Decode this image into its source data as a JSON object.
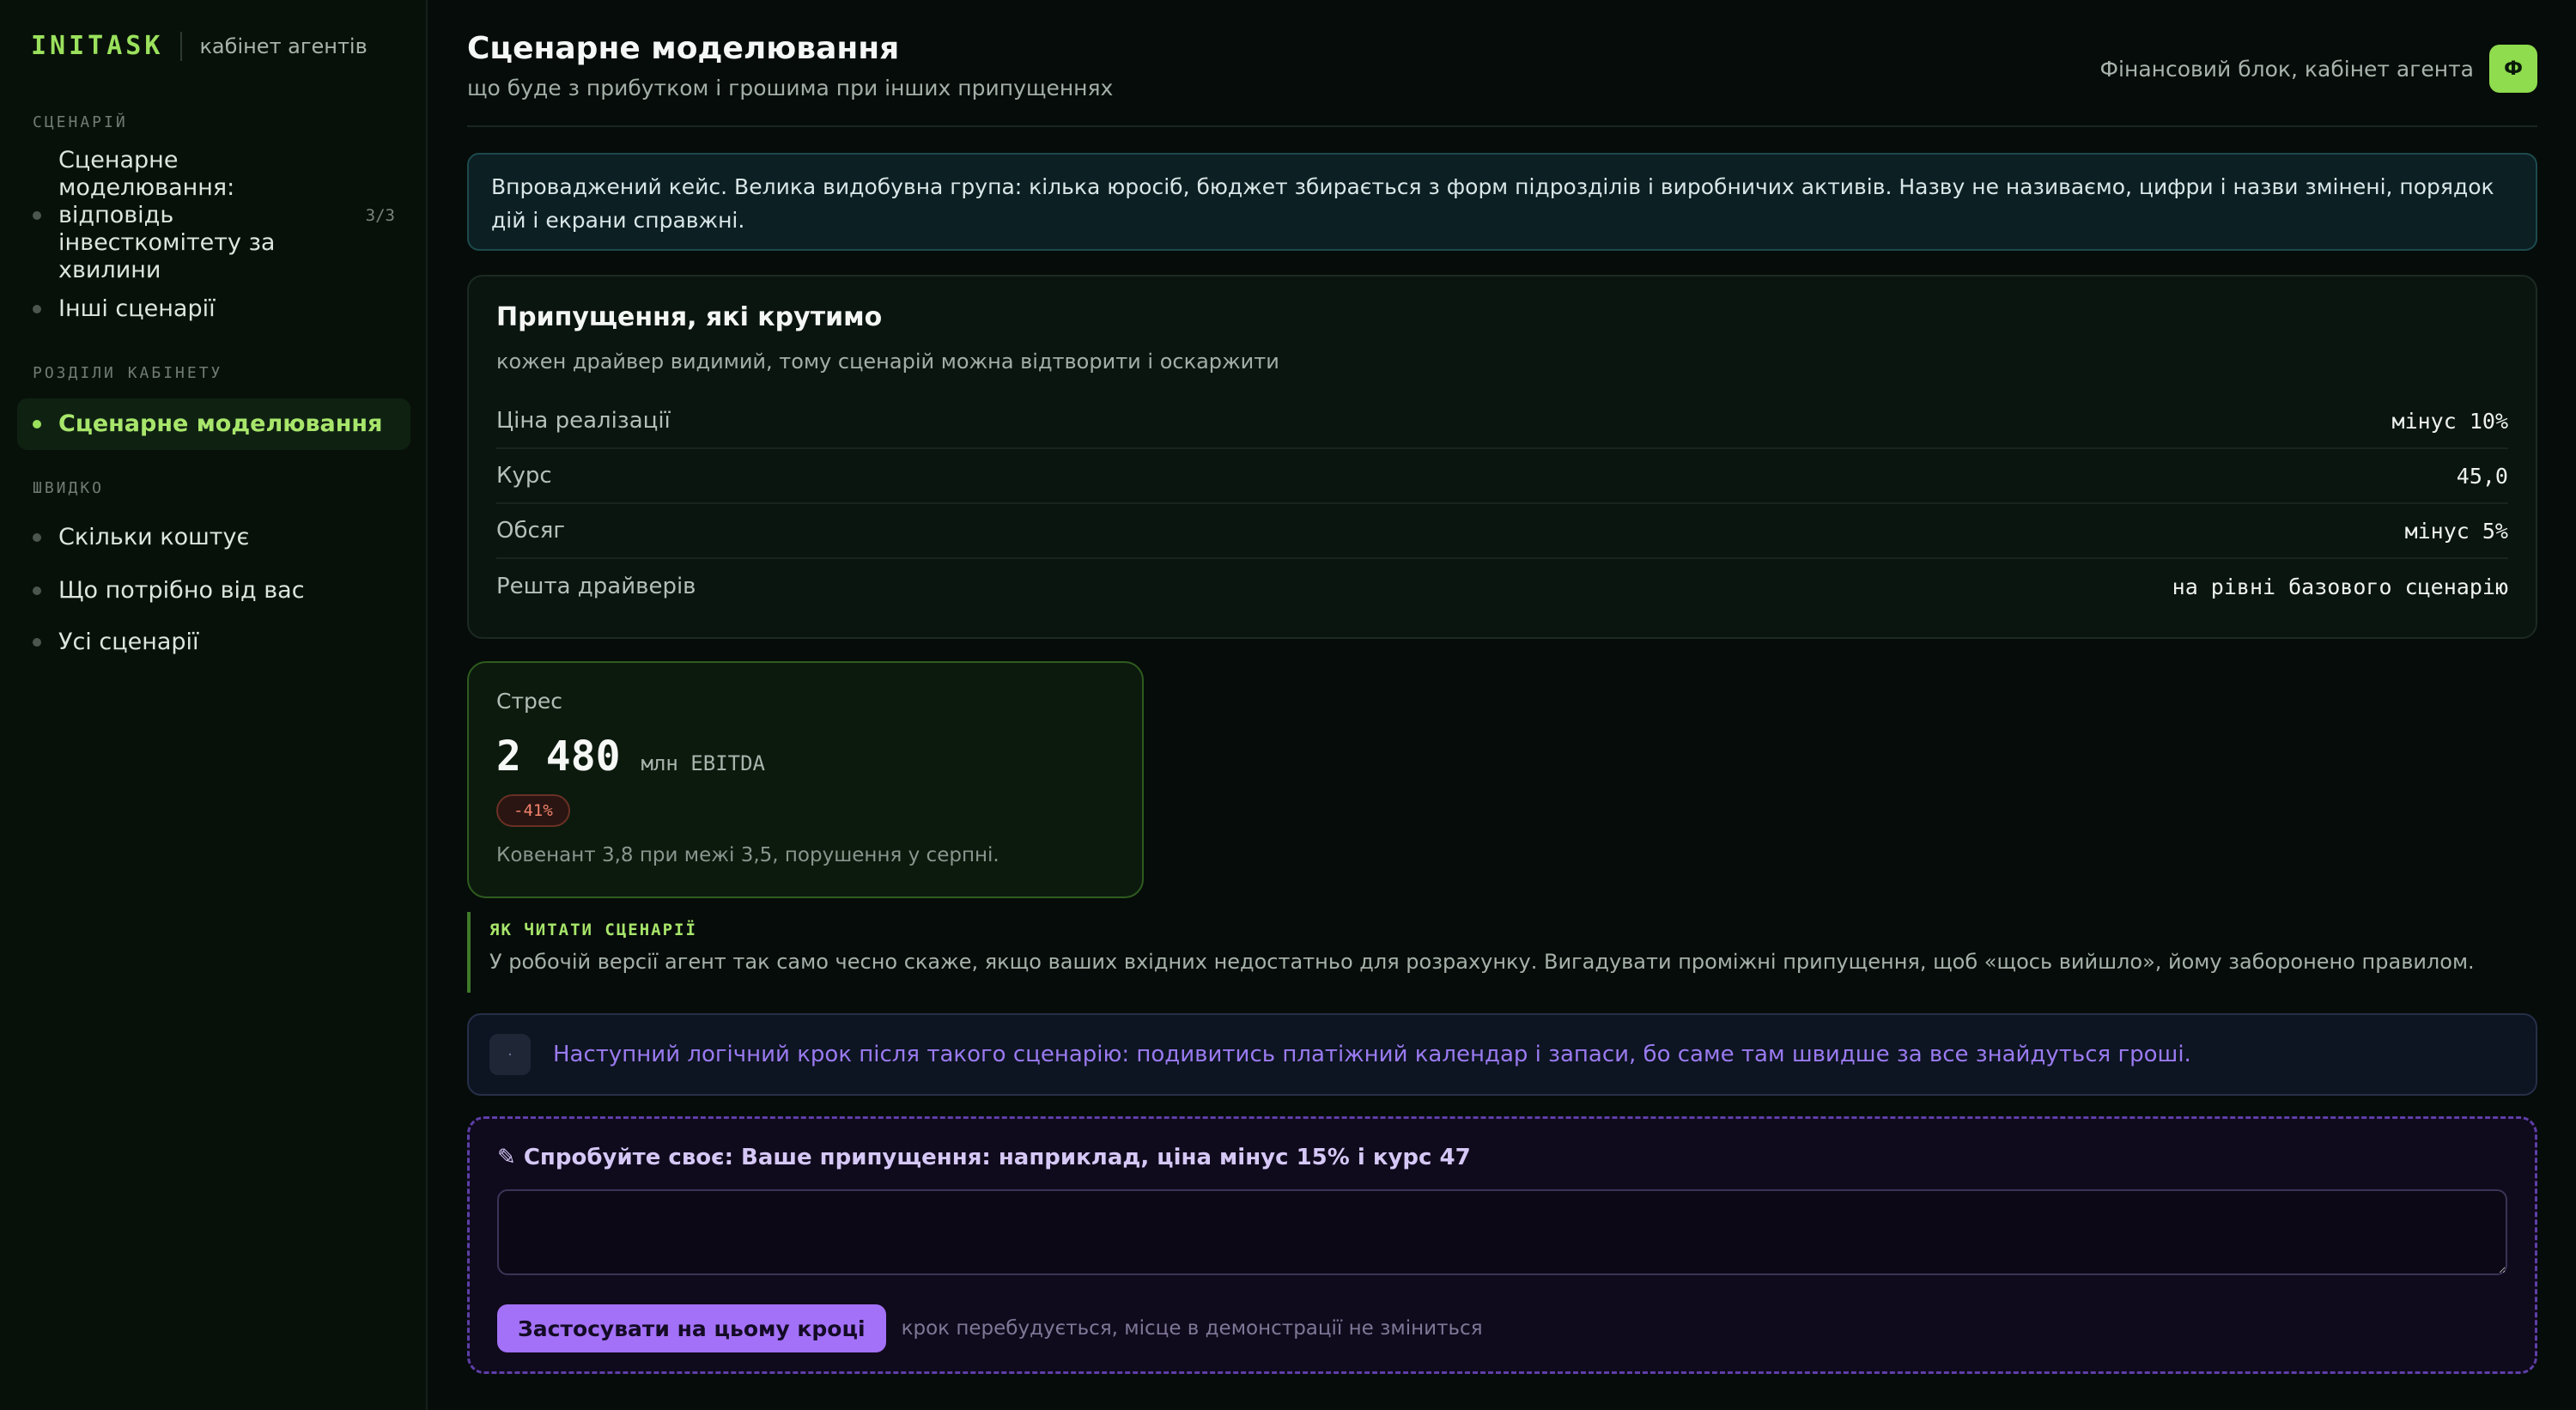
{
  "brand": {
    "logo": "INITASK",
    "subtitle": "кабінет агентів"
  },
  "sidebar": {
    "scenarios_heading": "СЦЕНАРІЙ",
    "scenarios": [
      {
        "label": "Сценарне моделювання: відповідь інвесткомітету за хвилини",
        "count": "3/3"
      },
      {
        "label": "Інші сценарії"
      }
    ],
    "sections_heading": "РОЗДІЛИ КАБІНЕТУ",
    "sections": [
      {
        "label": "Сценарне моделювання",
        "active": true
      }
    ],
    "quick_heading": "ШВИДКО",
    "quick": [
      {
        "label": "Скільки коштує"
      },
      {
        "label": "Що потрібно від вас"
      },
      {
        "label": "Усі сценарії"
      }
    ]
  },
  "header": {
    "title": "Сценарне моделювання",
    "subtitle": "що буде з прибутком і грошима при інших припущеннях",
    "context": "Фінансовий блок, кабінет агента",
    "avatar_letter": "Ф"
  },
  "banner": {
    "text": "Впроваджений кейс. Велика видобувна група: кілька юросіб, бюджет збирається з форм підрозділів і виробничих активів. Назву не називаємо, цифри і назви змінені, порядок дій і екрани справжні."
  },
  "assumptions": {
    "title": "Припущення, які крутимо",
    "subtitle": "кожен драйвер видимий, тому сценарій можна відтворити і оскаржити",
    "rows": [
      {
        "label": "Ціна реалізації",
        "value": "мінус 10%"
      },
      {
        "label": "Курс",
        "value": "45,0"
      },
      {
        "label": "Обсяг",
        "value": "мінус 5%"
      },
      {
        "label": "Решта драйверів",
        "value": "на рівні базового сценарію"
      }
    ]
  },
  "stress": {
    "label": "Стрес",
    "value": "2 480",
    "unit": "млн EBITDA",
    "delta": "-41%",
    "note": "Ковенант 3,8 при межі 3,5, порушення у серпні."
  },
  "note": {
    "title": "ЯК ЧИТАТИ СЦЕНАРІЇ",
    "text": "У робочій версії агент так само чесно скаже, якщо ваших вхідних недостатньо для розрахунку. Вигадувати проміжні припущення, щоб «щось вийшло», йому заборонено правилом."
  },
  "next_step": {
    "icon": "·",
    "text": "Наступний логічний крок після такого сценарію: подивитись платіжний календар і запаси, бо саме там швидше за все знайдуться гроші."
  },
  "try_own": {
    "title": "✎ Спробуйте своє: Ваше припущення: наприклад, ціна мінус 15% і курс 47",
    "input_value": "",
    "button_label": "Застосувати на цьому кроці",
    "hint": "крок перебудується, місце в демонстрації не зміниться"
  },
  "colors": {
    "accent": "#9be15d",
    "purple_accent": "#a371f7",
    "negative": "#f0826b"
  }
}
